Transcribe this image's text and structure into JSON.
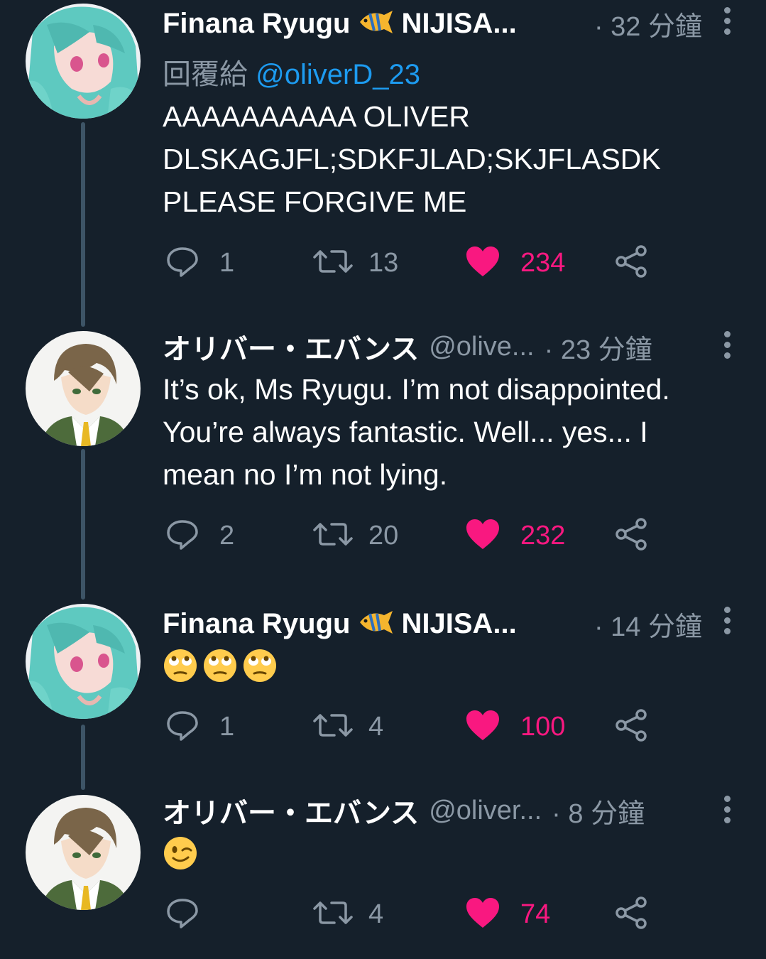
{
  "tweets": [
    {
      "name": "Finana Ryugu",
      "name_suffix": "NIJISA...",
      "name_emoji": "tropical-fish-icon",
      "handle": "",
      "time": "· 32 分鐘",
      "reply_label": "回覆給",
      "reply_mention": "@oliverD_23",
      "body": [
        "AAAAAAAAAA OLIVER",
        "DLSKAGJFL;SDKFJLAD;SKJFLASDK",
        "PLEASE FORGIVE ME"
      ],
      "reply_count": "1",
      "retweet_count": "13",
      "like_count": "234"
    },
    {
      "name": "オリバー・エバンス",
      "handle": "@olive...",
      "time": "· 23 分鐘",
      "body": [
        "It’s ok, Ms Ryugu. I’m not disappointed.",
        "You’re always fantastic. Well... yes... I",
        "mean no I’m not lying."
      ],
      "reply_count": "2",
      "retweet_count": "20",
      "like_count": "232"
    },
    {
      "name": "Finana Ryugu",
      "name_suffix": "NIJISA...",
      "name_emoji": "tropical-fish-icon",
      "handle": "",
      "time": "· 14 分鐘",
      "body_emojis": [
        "face-with-rolling-eyes",
        "face-with-rolling-eyes",
        "face-with-rolling-eyes"
      ],
      "reply_count": "1",
      "retweet_count": "4",
      "like_count": "100"
    },
    {
      "name": "オリバー・エバンス",
      "handle": "@oliver...",
      "time": "· 8 分鐘",
      "body_emojis": [
        "winking-face"
      ],
      "reply_count": "",
      "retweet_count": "4",
      "like_count": "74"
    }
  ],
  "colors": {
    "background": "#15202b",
    "secondary_text": "#8b98a5",
    "like": "#f91880",
    "mention": "#1d9bf0",
    "thread_line": "#3d5466"
  }
}
